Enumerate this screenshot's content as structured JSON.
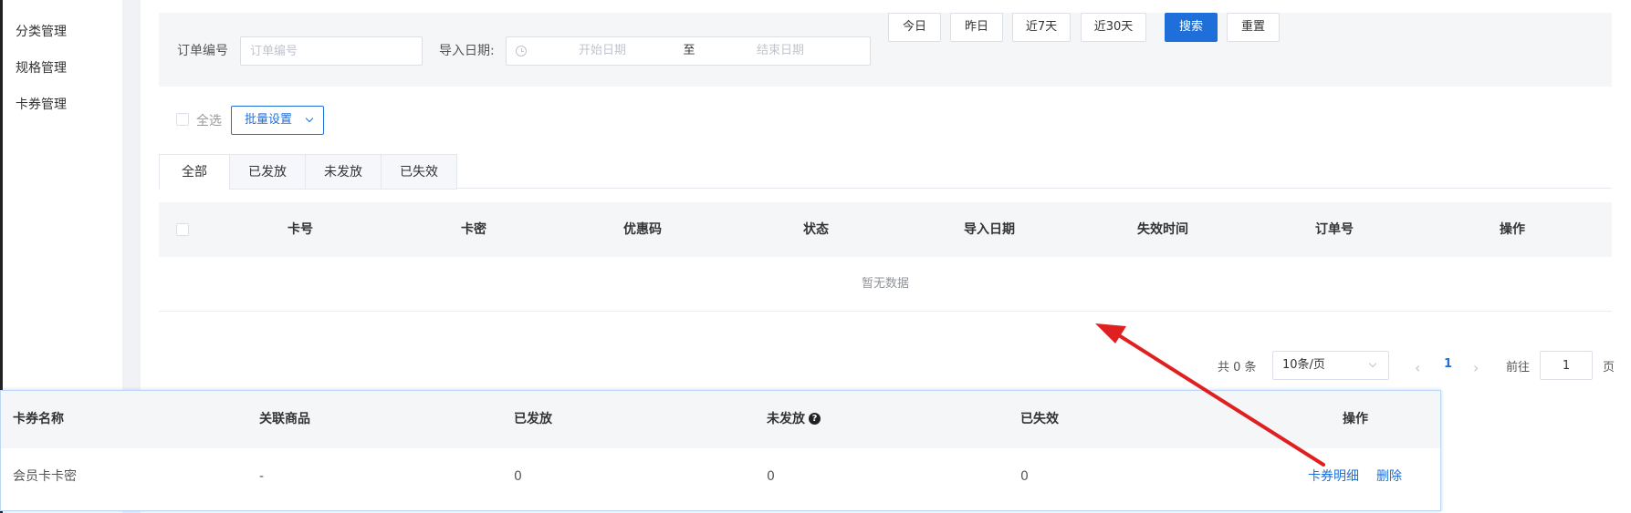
{
  "sidebar": {
    "items": [
      {
        "label": "分类管理"
      },
      {
        "label": "规格管理"
      },
      {
        "label": "卡券管理"
      }
    ]
  },
  "filter": {
    "order_label": "订单编号",
    "order_placeholder": "订单编号",
    "date_label": "导入日期:",
    "date_start_placeholder": "开始日期",
    "date_separator": "至",
    "date_end_placeholder": "结束日期",
    "quick_dates": [
      "今日",
      "昨日",
      "近7天",
      "近30天"
    ],
    "search_label": "搜索",
    "reset_label": "重置"
  },
  "batch": {
    "select_all_label": "全选",
    "batch_label": "批量设置"
  },
  "tabs": [
    {
      "label": "全部",
      "active": true
    },
    {
      "label": "已发放"
    },
    {
      "label": "未发放"
    },
    {
      "label": "已失效"
    }
  ],
  "table": {
    "headers": [
      "卡号",
      "卡密",
      "优惠码",
      "状态",
      "导入日期",
      "失效时间",
      "订单号",
      "操作"
    ],
    "empty_text": "暂无数据"
  },
  "pagination": {
    "total_text": "共 0 条",
    "page_size": "10条/页",
    "current_page": "1",
    "goto_label": "前往",
    "goto_value": "1",
    "page_unit": "页"
  },
  "overlay": {
    "headers": [
      "卡券名称",
      "关联商品",
      "已发放",
      "未发放",
      "已失效",
      "操作"
    ],
    "row": {
      "name": "会员卡卡密",
      "product": "-",
      "issued": "0",
      "unissued": "0",
      "expired": "0",
      "detail_link": "卡券明细",
      "delete_link": "删除"
    }
  },
  "colors": {
    "primary": "#1e6fd9",
    "annotation_arrow": "#e02020"
  }
}
